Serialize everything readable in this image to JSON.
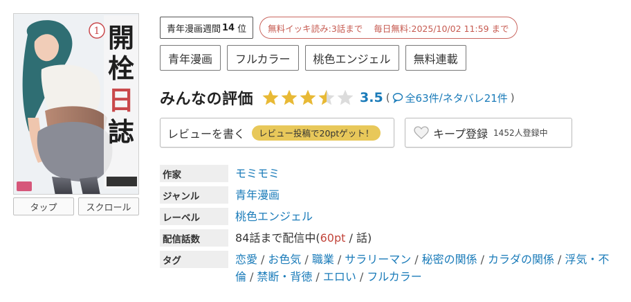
{
  "cover": {
    "title_chars": [
      "開",
      "栓",
      "日",
      "誌"
    ],
    "volume": "1"
  },
  "viewer": {
    "tap_label": "タップ",
    "scroll_label": "スクロール"
  },
  "ranking": {
    "label": "青年漫画週間",
    "rank": "14",
    "suffix": "位"
  },
  "free_info": {
    "binge": "無料イッキ読み:3話まで",
    "daily": "毎日無料:2025/10/02 11:59 まで"
  },
  "genre_tags": [
    "青年漫画",
    "フルカラー",
    "桃色エンジェル",
    "無料連載"
  ],
  "rating": {
    "title": "みんなの評価",
    "stars": 3.5,
    "value": "3.5",
    "paren_open": "(",
    "total": "全63件",
    "slash": "/",
    "spoiler": "ネタバレ21件",
    "paren_close": ")",
    "star_color": "#e8b935",
    "star_empty_color": "#dcdcdc"
  },
  "review_button": {
    "label": "レビューを書く",
    "promo": "レビュー投稿で20ptゲット！"
  },
  "keep_button": {
    "label": "キープ登録",
    "count": "1452人登録中"
  },
  "info": {
    "author_key": "作家",
    "author": "モミモミ",
    "genre_key": "ジャンル",
    "genre": "青年漫画",
    "label_key": "レーベル",
    "label": "桃色エンジェル",
    "episodes_key": "配信話数",
    "episodes_prefix": "84話まで配信中(",
    "episodes_pt": "60pt",
    "episodes_suffix": " / 話)",
    "tags_key": "タグ",
    "tags": [
      "恋愛",
      "お色気",
      "職業",
      "サラリーマン",
      "秘密の関係",
      "カラダの関係",
      "浮気・不倫",
      "禁断・背徳",
      "エロい",
      "フルカラー"
    ]
  },
  "colors": {
    "link": "#1a7bb9",
    "accent_red": "#c65a50",
    "promo_yellow": "#e8c85a"
  }
}
